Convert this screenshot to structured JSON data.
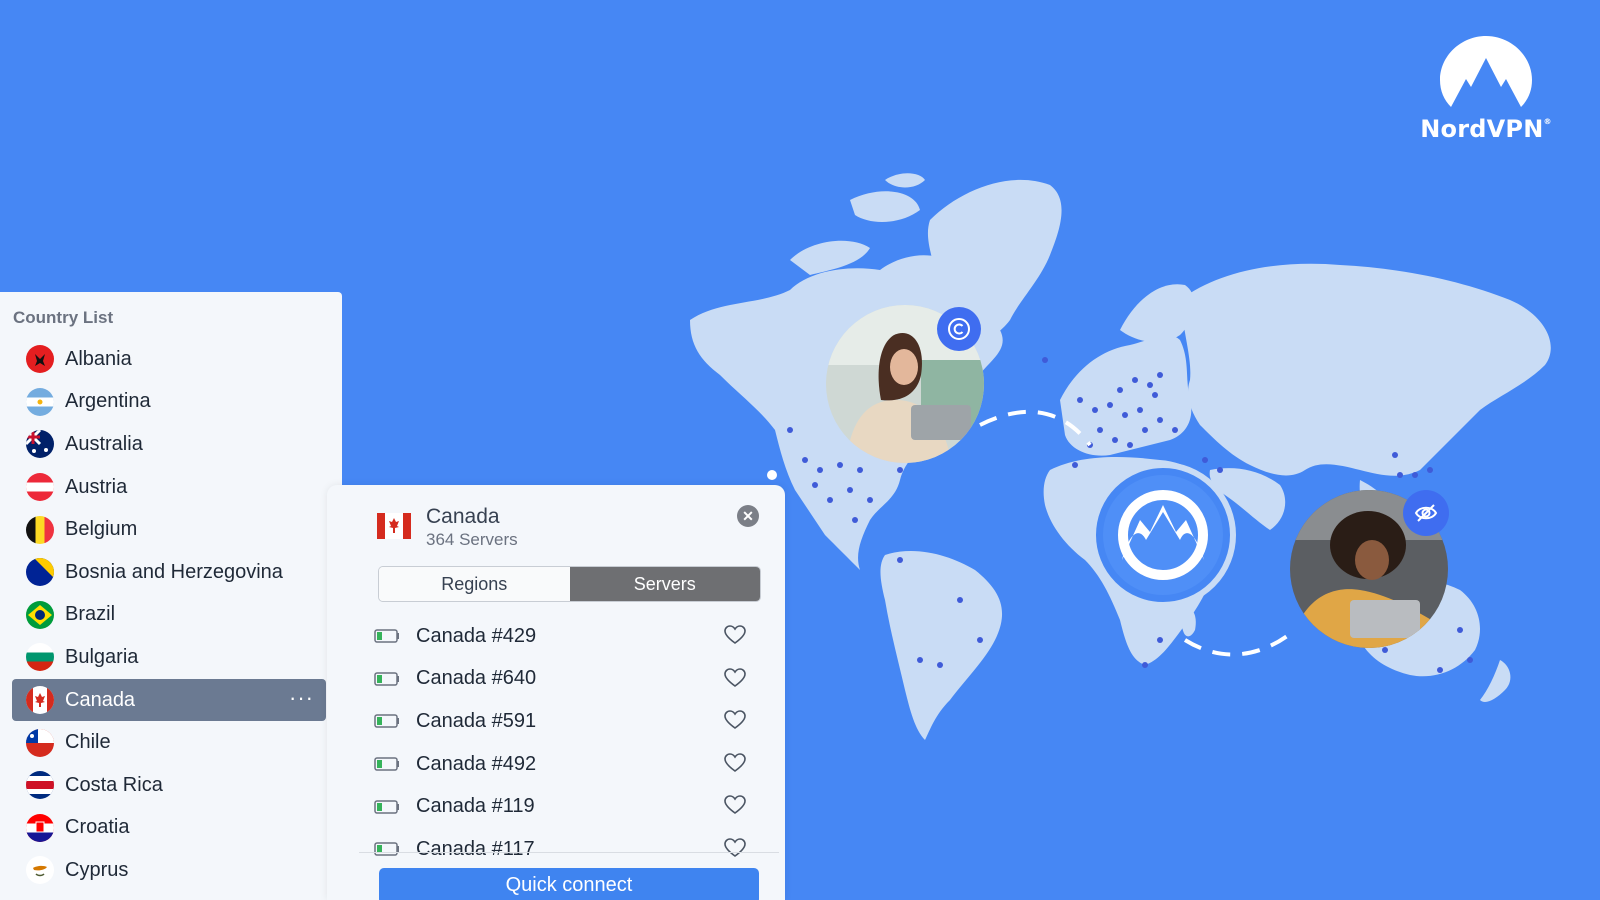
{
  "brand": {
    "name": "NordVPN",
    "mark": "®",
    "accent": "#4687f4"
  },
  "country_list": {
    "title": "Country List",
    "items": [
      {
        "label": "Albania",
        "flag": "albania-flag-icon"
      },
      {
        "label": "Argentina",
        "flag": "argentina-flag-icon"
      },
      {
        "label": "Australia",
        "flag": "australia-flag-icon"
      },
      {
        "label": "Austria",
        "flag": "austria-flag-icon"
      },
      {
        "label": "Belgium",
        "flag": "belgium-flag-icon"
      },
      {
        "label": "Bosnia and Herzegovina",
        "flag": "bosnia-flag-icon"
      },
      {
        "label": "Brazil",
        "flag": "brazil-flag-icon"
      },
      {
        "label": "Bulgaria",
        "flag": "bulgaria-flag-icon"
      },
      {
        "label": "Canada",
        "flag": "canada-flag-icon",
        "selected": true
      },
      {
        "label": "Chile",
        "flag": "chile-flag-icon"
      },
      {
        "label": "Costa Rica",
        "flag": "costa-rica-flag-icon"
      },
      {
        "label": "Croatia",
        "flag": "croatia-flag-icon"
      },
      {
        "label": "Cyprus",
        "flag": "cyprus-flag-icon"
      }
    ],
    "more_label": "···"
  },
  "server_panel": {
    "country": "Canada",
    "servers_count": "364 Servers",
    "tabs": {
      "regions": "Regions",
      "servers": "Servers",
      "active": "Servers"
    },
    "servers": [
      "Canada #429",
      "Canada #640",
      "Canada #591",
      "Canada #492",
      "Canada #119",
      "Canada #117"
    ],
    "quick_connect": "Quick connect",
    "close_label": "✕"
  }
}
